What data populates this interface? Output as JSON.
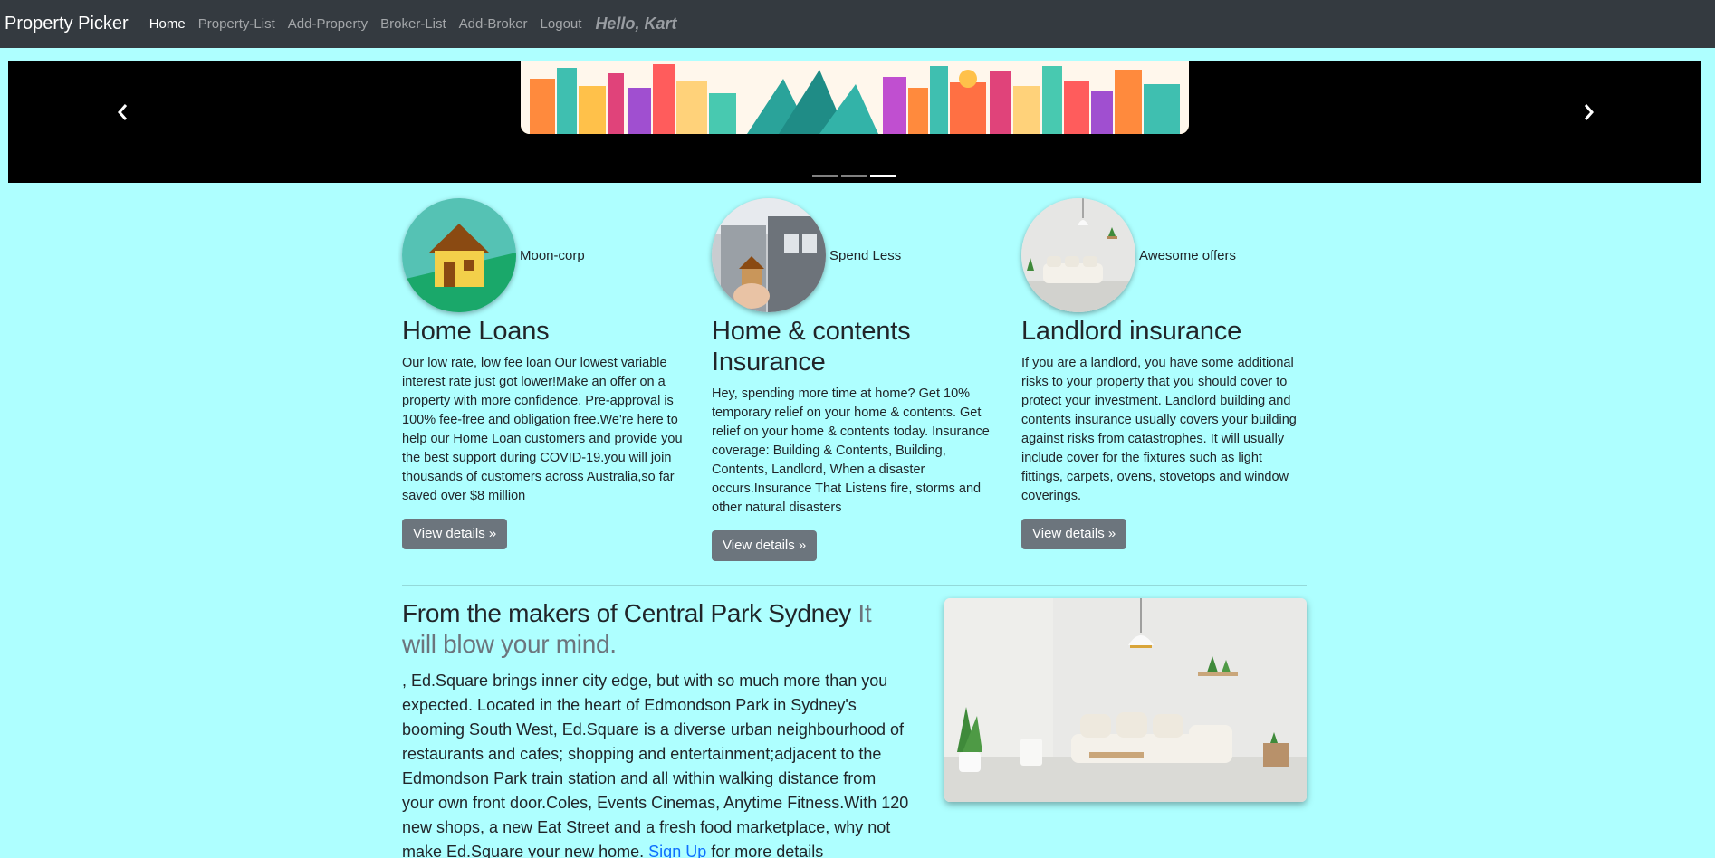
{
  "nav": {
    "brand": "Property Picker",
    "links": [
      "Home",
      "Property-List",
      "Add-Property",
      "Broker-List",
      "Add-Broker",
      "Logout"
    ],
    "active": "Home",
    "greeting": "Hello, Kart"
  },
  "carousel": {
    "slide_count": 3,
    "active_index": 2
  },
  "features": [
    {
      "caption": "Moon-corp",
      "title": "Home Loans",
      "text": "Our low rate, low fee loan Our lowest variable interest rate just got lower!Make an offer on a property with more confidence. Pre-approval is 100% fee-free and obligation free.We're here to help our Home Loan customers and provide you the best support during COVID-19.you will join thousands of customers across Australia,so far saved over $8 million",
      "button": "View details »"
    },
    {
      "caption": "Spend Less",
      "title": "Home & contents Insurance",
      "text": "Hey, spending more time at home? Get 10% temporary relief on your home & contents. Get relief on your home & contents today. Insurance coverage: Building & Contents, Building, Contents, Landlord, When a disaster occurs.Insurance That Listens fire, storms and other natural disasters",
      "button": "View details »"
    },
    {
      "caption": "Awesome offers",
      "title": "Landlord insurance",
      "text": "If you are a landlord, you have some additional risks to your property that you should cover to protect your investment. Landlord building and contents insurance usually covers your building against risks from catastrophes. It will usually include cover for the fixtures such as light fittings, carpets, ovens, stovetops and window coverings.",
      "button": "View details »"
    }
  ],
  "featurette": {
    "heading": "From the makers of Central Park Sydney",
    "heading_muted": "It will blow your mind.",
    "text": ", Ed.Square brings inner city edge, but with so much more than you expected. Located in the heart of Edmondson Park in Sydney's booming South West, Ed.Square is a diverse urban neighbourhood of restaurants and cafes; shopping and entertainment;adjacent to the Edmondson Park train station and all within walking distance from your own front door.Coles, Events Cinemas, Anytime Fitness.With 120 new shops, a new Eat Street and a fresh food marketplace, why not make Ed.Square your new home.",
    "link": "Sign Up",
    "text_after": " for more details"
  },
  "colors": {
    "page_bg": "#aeffff",
    "navbar_bg": "#343a40",
    "button_bg": "#6c757d",
    "link": "#0d6efd"
  },
  "icons": [
    "chevron-left-icon",
    "chevron-right-icon",
    "house-icon"
  ]
}
